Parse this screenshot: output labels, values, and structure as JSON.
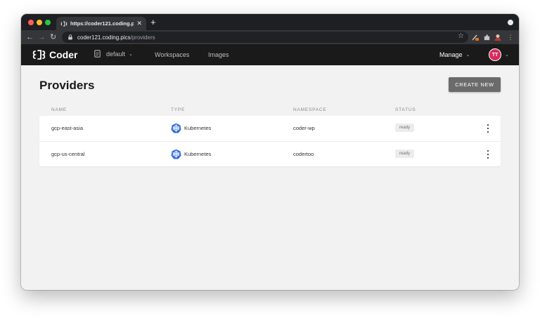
{
  "browser": {
    "tab_title": "https://coder121.coding.pics/p",
    "address_host": "coder121.coding.pics",
    "address_path": "/providers",
    "traffic_colors": [
      "#ff5f57",
      "#febc2e",
      "#28c840"
    ]
  },
  "app": {
    "logo_text": "Coder",
    "org_name": "default",
    "nav": [
      "Workspaces",
      "Images"
    ],
    "manage_label": "Manage",
    "avatar_initials": "TT"
  },
  "page": {
    "title": "Providers",
    "create_button": "CREATE NEW"
  },
  "table": {
    "headers": [
      "NAME",
      "TYPE",
      "NAMESPACE",
      "STATUS"
    ],
    "rows": [
      {
        "name": "gcp-east-asia",
        "type": "Kubernetes",
        "namespace": "coder-wp",
        "status": "ready"
      },
      {
        "name": "gcp-us-central",
        "type": "Kubernetes",
        "namespace": "codertoo",
        "status": "ready"
      }
    ]
  },
  "icons": {
    "type_icon": "kubernetes-icon",
    "row_menu": "more-vertical-icon",
    "kubernetes_color": "#326ce5"
  }
}
